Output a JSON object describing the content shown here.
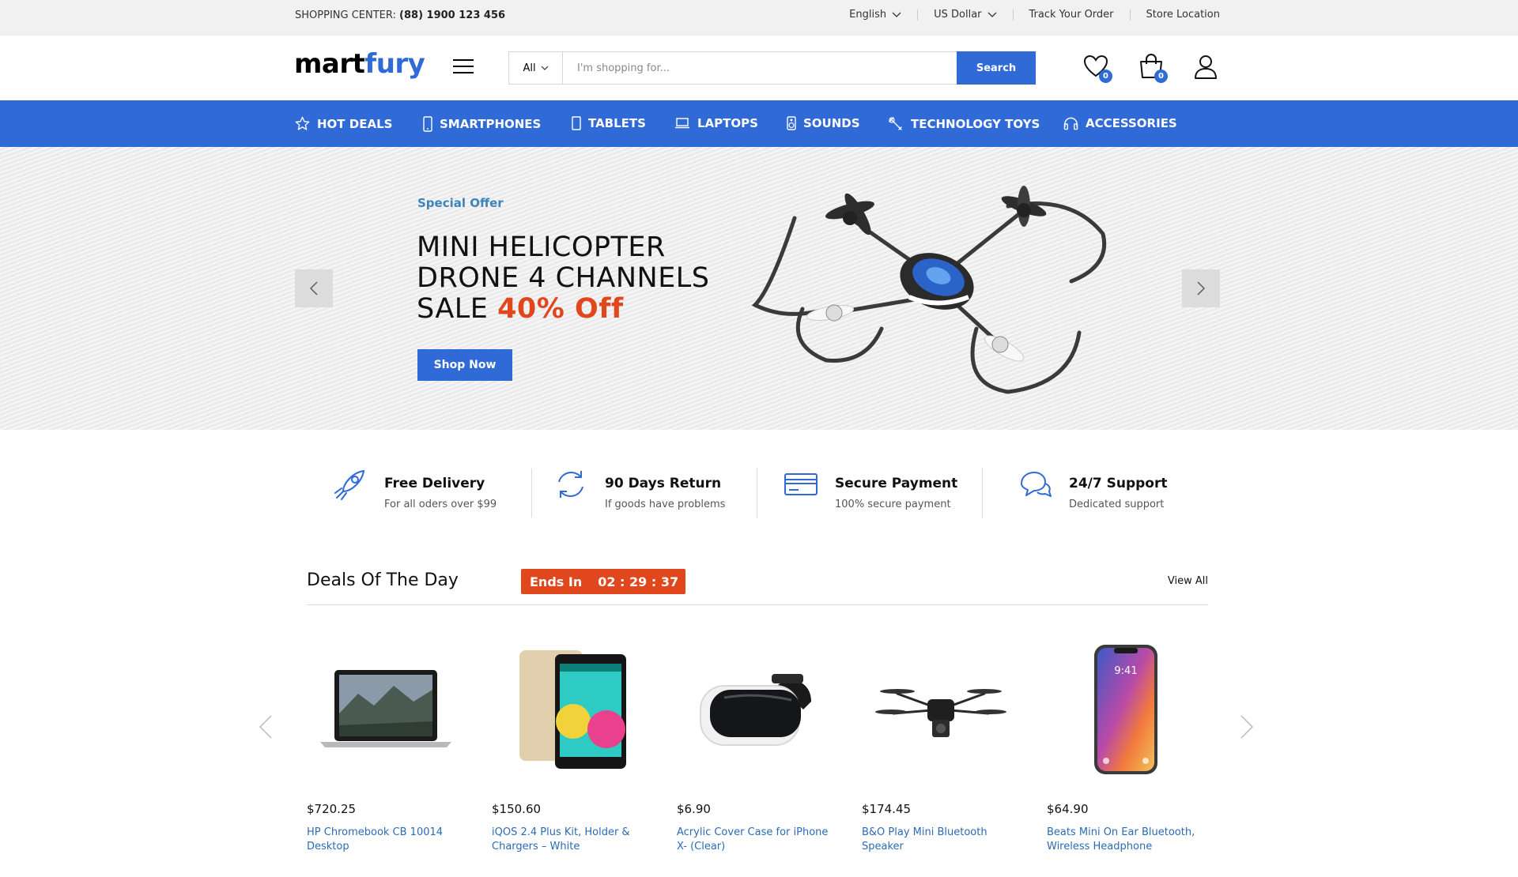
{
  "topbar": {
    "shopping_center_label": "SHOPPING CENTER:",
    "phone": "(88) 1900 123 456",
    "language": "English",
    "currency": "US Dollar",
    "track_order": "Track Your Order",
    "store_location": "Store Location"
  },
  "header": {
    "logo_part1": "mart",
    "logo_part2": "fury",
    "search_category": "All",
    "search_placeholder": "I'm shopping for...",
    "search_button": "Search",
    "wishlist_count": "0",
    "cart_count": "0"
  },
  "nav": {
    "items": [
      {
        "label": "HOT DEALS",
        "icon": "star-icon"
      },
      {
        "label": "SMARTPHONES",
        "icon": "smartphone-icon"
      },
      {
        "label": "TABLETS",
        "icon": "tablet-icon"
      },
      {
        "label": "LAPTOPS",
        "icon": "laptop-icon"
      },
      {
        "label": "SOUNDS",
        "icon": "speaker-icon"
      },
      {
        "label": "TECHNOLOGY TOYS",
        "icon": "toy-icon"
      },
      {
        "label": "ACCESSORIES",
        "icon": "headphones-icon"
      }
    ]
  },
  "hero": {
    "offer_label": "Special Offer",
    "title_line1": "MINI HELICOPTER",
    "title_line2": "DRONE 4 CHANNELS",
    "title_line3_prefix": "SALE",
    "title_line3_highlight": "40% Off",
    "button": "Shop Now"
  },
  "features": [
    {
      "title": "Free Delivery",
      "subtitle": "For all oders over $99",
      "icon": "rocket-icon"
    },
    {
      "title": "90 Days Return",
      "subtitle": "If goods have problems",
      "icon": "refresh-icon"
    },
    {
      "title": "Secure Payment",
      "subtitle": "100% secure payment",
      "icon": "credit-card-icon"
    },
    {
      "title": "24/7 Support",
      "subtitle": "Dedicated support",
      "icon": "chat-icon"
    }
  ],
  "deals": {
    "title": "Deals Of The Day",
    "ends_in_label": "Ends In",
    "countdown": "02 : 29 : 37",
    "view_all": "View All",
    "products": [
      {
        "price": "$720.25",
        "name": "HP Chromebook CB 10014 Desktop"
      },
      {
        "price": "$150.60",
        "name": "iQOS 2.4 Plus Kit, Holder & Chargers – White"
      },
      {
        "price": "$6.90",
        "name": "Acrylic Cover Case for iPhone X- (Clear)"
      },
      {
        "price": "$174.45",
        "name": "B&O Play Mini Bluetooth Speaker"
      },
      {
        "price": "$64.90",
        "name": "Beats Mini On Ear Bluetooth, Wireless Headphone"
      }
    ]
  },
  "colors": {
    "brand_blue": "#2f6ad6",
    "sale_orange": "#e0471c",
    "link_blue": "#2a6bb5",
    "offer_blue": "#3c84ba"
  }
}
